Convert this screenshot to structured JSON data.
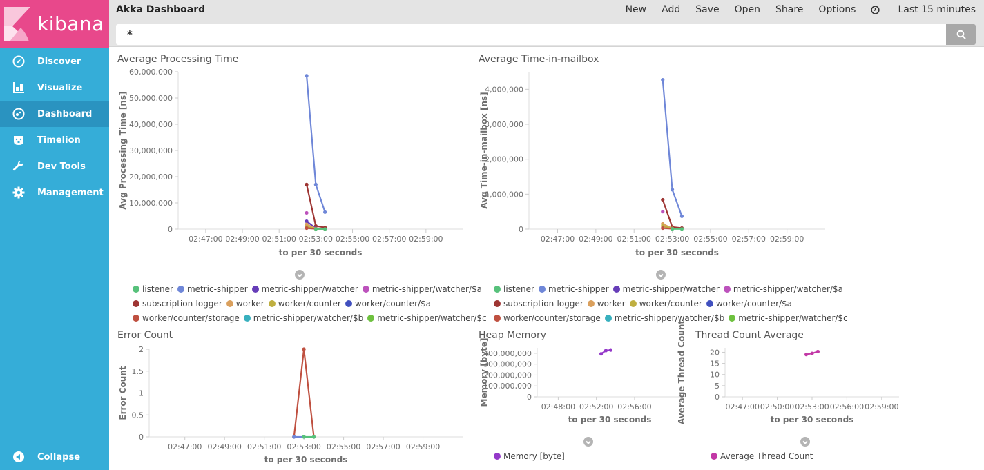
{
  "app": {
    "brand": "kibana",
    "title": "Akka Dashboard"
  },
  "sidebar": {
    "items": [
      {
        "label": "Discover",
        "icon": "compass-icon"
      },
      {
        "label": "Visualize",
        "icon": "bar-chart-icon"
      },
      {
        "label": "Dashboard",
        "icon": "dashboard-icon",
        "active": true
      },
      {
        "label": "Timelion",
        "icon": "timelion-bear-icon"
      },
      {
        "label": "Dev Tools",
        "icon": "wrench-icon"
      },
      {
        "label": "Management",
        "icon": "gear-icon"
      }
    ],
    "collapse_label": "Collapse"
  },
  "topmenu": {
    "new": "New",
    "add": "Add",
    "save": "Save",
    "open": "Open",
    "share": "Share",
    "options": "Options",
    "time_range": "Last 15 minutes"
  },
  "search": {
    "value": "*"
  },
  "colors": {
    "brand": "#e8488b",
    "sidebar": "#35add8",
    "sidebar_active": "#2a93c0",
    "listener": "#57c17b",
    "metric-shipper": "#6f87d8",
    "metric-shipper/watcher": "#663db8",
    "metric-shipper/watcher/$a": "#bc52bc",
    "subscription-logger": "#9e3533",
    "worker": "#daa05d",
    "worker/counter": "#bfaf40",
    "worker/counter/$a": "#4050bf",
    "worker/counter/storage": "#bf5040",
    "metric-shipper/watcher/$b": "#38b0be",
    "metric-shipper/watcher/$c": "#6ec13f",
    "memory": "#9439c9",
    "thread": "#c238a6"
  },
  "chart_data": [
    {
      "id": "avg-processing-time",
      "type": "line",
      "title": "Average Processing Time",
      "xlabel": "to per 30 seconds",
      "ylabel": "Avg Processing Time [ns]",
      "x_ticks": [
        "02:47:00",
        "02:49:00",
        "02:51:00",
        "02:53:00",
        "02:55:00",
        "02:57:00",
        "02:59:00"
      ],
      "y_ticks": [
        "0",
        "10,000,000",
        "20,000,000",
        "30,000,000",
        "40,000,000",
        "50,000,000",
        "60,000,000"
      ],
      "ylim": [
        0,
        60000000
      ],
      "x_range_min": [
        165.5,
        181
      ],
      "x_tick_values": [
        167,
        169,
        171,
        173,
        175,
        177,
        179
      ],
      "series": [
        {
          "name": "metric-shipper",
          "x": [
            172.5,
            173,
            173.5
          ],
          "values": [
            58500000,
            17000000,
            6500000
          ]
        },
        {
          "name": "subscription-logger",
          "x": [
            172.5,
            173,
            173.5
          ],
          "values": [
            17000000,
            1200000,
            600000
          ]
        },
        {
          "name": "metric-shipper/watcher/$a",
          "x": [
            172.5
          ],
          "values": [
            6200000
          ]
        },
        {
          "name": "metric-shipper/watcher",
          "x": [
            172.5,
            173
          ],
          "values": [
            3000000,
            300000
          ]
        },
        {
          "name": "worker",
          "x": [
            172.5,
            173
          ],
          "values": [
            1800000,
            200000
          ]
        },
        {
          "name": "worker/counter",
          "x": [
            172.5,
            173
          ],
          "values": [
            900000,
            100000
          ]
        },
        {
          "name": "worker/counter/storage",
          "x": [
            172.5,
            173,
            173.5
          ],
          "values": [
            400000,
            100000,
            50000
          ]
        },
        {
          "name": "listener",
          "x": [
            173,
            173.5
          ],
          "values": [
            50000,
            50000
          ]
        }
      ],
      "legend": [
        "listener",
        "metric-shipper",
        "metric-shipper/watcher",
        "metric-shipper/watcher/$a",
        "subscription-logger",
        "worker",
        "worker/counter",
        "worker/counter/$a",
        "worker/counter/storage",
        "metric-shipper/watcher/$b",
        "metric-shipper/watcher/$c"
      ]
    },
    {
      "id": "avg-time-in-mailbox",
      "type": "line",
      "title": "Average Time-in-mailbox",
      "xlabel": "to per 30 seconds",
      "ylabel": "Avg Time-in-mailbox [ns]",
      "x_ticks": [
        "02:47:00",
        "02:49:00",
        "02:51:00",
        "02:53:00",
        "02:55:00",
        "02:57:00",
        "02:59:00"
      ],
      "y_ticks": [
        "0",
        "1,000,000",
        "2,000,000",
        "3,000,000",
        "4,000,000"
      ],
      "ylim": [
        0,
        4500000
      ],
      "x_range_min": [
        165.5,
        181
      ],
      "x_tick_values": [
        167,
        169,
        171,
        173,
        175,
        177,
        179
      ],
      "series": [
        {
          "name": "metric-shipper",
          "x": [
            172.5,
            173,
            173.5
          ],
          "values": [
            4270000,
            1130000,
            370000
          ]
        },
        {
          "name": "subscription-logger",
          "x": [
            172.5,
            173,
            173.5
          ],
          "values": [
            840000,
            60000,
            30000
          ]
        },
        {
          "name": "metric-shipper/watcher/$a",
          "x": [
            172.5
          ],
          "values": [
            500000
          ]
        },
        {
          "name": "worker",
          "x": [
            172.5,
            173
          ],
          "values": [
            150000,
            20000
          ]
        },
        {
          "name": "worker/counter",
          "x": [
            172.5,
            173
          ],
          "values": [
            90000,
            10000
          ]
        },
        {
          "name": "worker/counter/storage",
          "x": [
            172.5,
            173
          ],
          "values": [
            30000,
            10000
          ]
        },
        {
          "name": "listener",
          "x": [
            173,
            173.5
          ],
          "values": [
            5000,
            5000
          ]
        }
      ],
      "legend": [
        "listener",
        "metric-shipper",
        "metric-shipper/watcher",
        "metric-shipper/watcher/$a",
        "subscription-logger",
        "worker",
        "worker/counter",
        "worker/counter/$a",
        "worker/counter/storage",
        "metric-shipper/watcher/$b",
        "metric-shipper/watcher/$c"
      ]
    },
    {
      "id": "error-count",
      "type": "line",
      "title": "Error Count",
      "xlabel": "to per 30 seconds",
      "ylabel": "Error Count",
      "x_ticks": [
        "02:47:00",
        "02:49:00",
        "02:51:00",
        "02:53:00",
        "02:55:00",
        "02:57:00",
        "02:59:00"
      ],
      "y_ticks": [
        "0",
        "0.5",
        "1",
        "1.5",
        "2"
      ],
      "ylim": [
        0,
        2
      ],
      "x_range_min": [
        165.2,
        181
      ],
      "x_tick_values": [
        167,
        169,
        171,
        173,
        175,
        177,
        179
      ],
      "series": [
        {
          "name": "worker/counter/storage",
          "x": [
            172.5,
            173,
            173.5
          ],
          "values": [
            0,
            2,
            0
          ]
        },
        {
          "name": "metric-shipper",
          "x": [
            172.5,
            173
          ],
          "values": [
            0,
            0
          ]
        },
        {
          "name": "listener",
          "x": [
            173,
            173.5
          ],
          "values": [
            0,
            0
          ]
        }
      ]
    },
    {
      "id": "heap-memory",
      "type": "line",
      "title": "Heap Memory",
      "xlabel": "to per 30 seconds",
      "ylabel": "Memory [byte]",
      "x_ticks": [
        "02:48:00",
        "02:52:00",
        "02:56:00"
      ],
      "y_ticks": [
        "0",
        "100,000,000",
        "200,000,000",
        "300,000,000",
        "400,000,000"
      ],
      "ylim": [
        0,
        450000000
      ],
      "x_range_min": [
        165.8,
        181
      ],
      "x_tick_values": [
        168,
        172,
        176
      ],
      "series": [
        {
          "name": "Memory [byte]",
          "x": [
            172.5,
            173,
            173.5
          ],
          "values": [
            395000000,
            425000000,
            430000000
          ]
        }
      ],
      "legend": [
        "Memory [byte]"
      ]
    },
    {
      "id": "thread-count-average",
      "type": "line",
      "title": "Thread Count Average",
      "xlabel": "to per 30 seconds",
      "ylabel": "Average Thread Count",
      "x_ticks": [
        "02:47:00",
        "02:50:00",
        "02:53:00",
        "02:56:00",
        "02:59:00"
      ],
      "y_ticks": [
        "0",
        "5",
        "10",
        "15",
        "20"
      ],
      "ylim": [
        0,
        22
      ],
      "x_range_min": [
        165.5,
        180.5
      ],
      "x_tick_values": [
        167,
        170,
        173,
        176,
        179
      ],
      "series": [
        {
          "name": "Average Thread Count",
          "x": [
            172.5,
            173,
            173.5
          ],
          "values": [
            19,
            19.5,
            20.3
          ]
        }
      ],
      "legend": [
        "Average Thread Count"
      ]
    }
  ]
}
